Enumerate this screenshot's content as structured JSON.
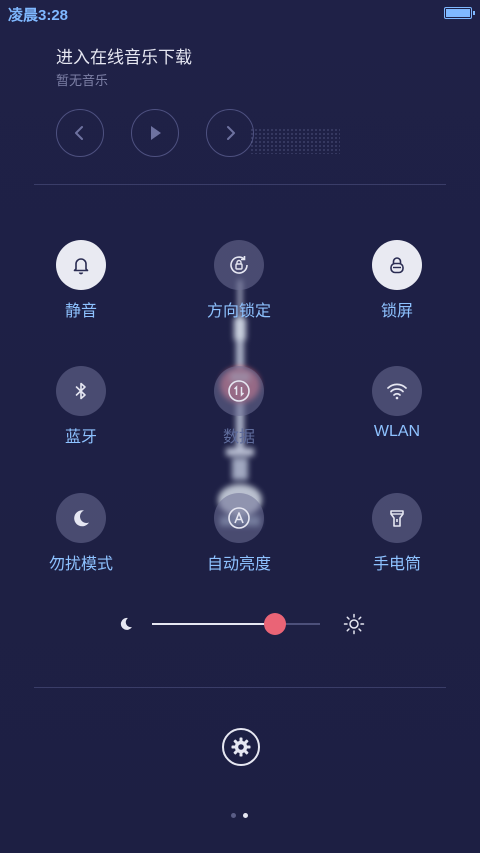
{
  "status": {
    "time": "凌晨3:28",
    "battery_level": 1.0
  },
  "music": {
    "title": "进入在线音乐下载",
    "subtitle": "暂无音乐"
  },
  "toggles": [
    {
      "label": "静音",
      "icon": "bell-icon",
      "active": true
    },
    {
      "label": "方向锁定",
      "icon": "rotation-lock-icon",
      "active": false
    },
    {
      "label": "锁屏",
      "icon": "lock-icon",
      "active": true
    },
    {
      "label": "蓝牙",
      "icon": "bluetooth-icon",
      "active": false
    },
    {
      "label": "数据",
      "icon": "data-transfer-icon",
      "active": false
    },
    {
      "label": "WLAN",
      "icon": "wifi-icon",
      "active": false
    },
    {
      "label": "勿扰模式",
      "icon": "moon-icon",
      "active": false
    },
    {
      "label": "自动亮度",
      "icon": "auto-brightness-icon",
      "active": false
    },
    {
      "label": "手电筒",
      "icon": "flashlight-icon",
      "active": false
    }
  ],
  "brightness": {
    "level": 0.73
  },
  "pager": {
    "count": 2,
    "current": 1
  },
  "colors": {
    "background": "#1f2147",
    "label": "#8ec2ff",
    "slider_knob": "#ea6476"
  }
}
